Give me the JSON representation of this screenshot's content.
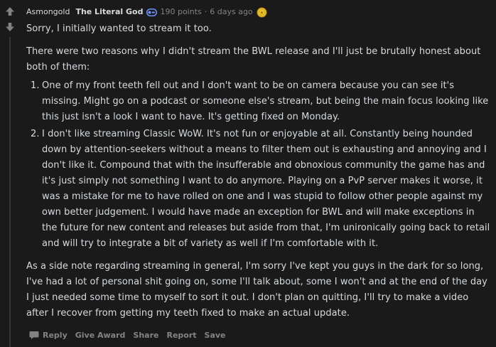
{
  "comment": {
    "author": "Asmongold",
    "flair": "The Literal God",
    "points": "190 points",
    "separator": "·",
    "time": "6 days ago",
    "paragraphs": [
      "Sorry, I initially wanted to stream it too.",
      "There were two reasons why I didn't stream the BWL release and I'll just be brutally honest about both of them:"
    ],
    "list": [
      {
        "number": "1.",
        "text": "One of my front teeth fell out and I don't want to be on camera because you can see it's missing. Might go on a podcast or someone else's stream, but being the main focus looking like this just isn't a look I want to have. It's getting fixed on Monday."
      },
      {
        "number": "2.",
        "text": "I don't like streaming Classic WoW. It's not fun or enjoyable at all. Constantly being hounded down by attention-seekers without a means to filter them out is exhausting and annoying and I don't like it. Compound that with the insufferable and obnoxious community the game has and it's just simply not something I want to do anymore. Playing on a PvP server makes it worse, it was a mistake for me to have rolled on one and I was stupid to follow other people against my own better judgement. I would have made an exception for BWL and will make exceptions in the future for new content and releases but aside from that, I'm unironically going back to retail and will try to integrate a bit of variety as well if I'm comfortable with it."
      }
    ],
    "closing": "As a side note regarding streaming in general, I'm sorry I've kept you guys in the dark for so long, I've had a lot of personal shit going on, some I'll talk about, some I won't and at the end of the day I just needed some time to myself to sort it out. I don't plan on quitting, I'll try to make a video after I recover from getting my teeth fixed to make an actual update."
  },
  "actions": {
    "reply": "Reply",
    "give_award": "Give Award",
    "share": "Share",
    "report": "Report",
    "save": "Save"
  },
  "icons": {
    "upvote": "arrow-up-icon",
    "downvote": "arrow-down-icon",
    "op_badge": "op-badge-icon",
    "award": "gold-award-icon",
    "reply": "comment-bubble-icon"
  },
  "colors": {
    "background": "#1a1a1b",
    "text": "#d7dadc",
    "muted": "#818384",
    "award_gold": "#e8c12e",
    "badge_blue": "#7193ff"
  }
}
